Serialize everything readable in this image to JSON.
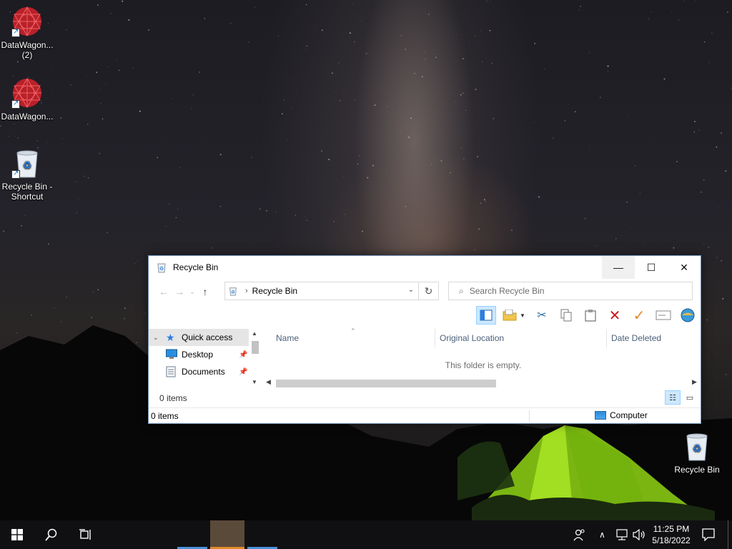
{
  "desktop": {
    "icons": [
      {
        "label": "DataWagon...\n(2)",
        "icon": "datawagon-icon",
        "shortcut": true
      },
      {
        "label": "DataWagon...",
        "icon": "datawagon-icon",
        "shortcut": true
      },
      {
        "label": "Recycle Bin - Shortcut",
        "icon": "recycle-bin-icon",
        "shortcut": true
      },
      {
        "label": "Recycle Bin",
        "icon": "recycle-bin-icon",
        "shortcut": false
      }
    ]
  },
  "window": {
    "title": "Recycle Bin",
    "controls": {
      "minimize": "—",
      "maximize": "☐",
      "close": "✕"
    },
    "address": {
      "crumb": "Recycle Bin",
      "sep": "›"
    },
    "search": {
      "placeholder": "Search Recycle Bin"
    },
    "toolbar_icons": [
      "preview-pane-icon",
      "new-folder-icon",
      "cut-icon",
      "copy-icon",
      "paste-icon",
      "delete-icon",
      "checkmark-icon",
      "rename-icon",
      "properties-icon"
    ],
    "nav_pane": {
      "items": [
        {
          "label": "Quick access",
          "icon": "star-icon",
          "selected": true,
          "expander": "⌄"
        },
        {
          "label": "Desktop",
          "icon": "desktop-folder-icon",
          "pinned": true
        },
        {
          "label": "Documents",
          "icon": "documents-folder-icon",
          "pinned": true
        }
      ],
      "items_count": "0 items"
    },
    "columns": [
      "Name",
      "Original Location",
      "Date Deleted"
    ],
    "empty_message": "This folder is empty.",
    "status": {
      "items": "0 items",
      "location": "Computer"
    }
  },
  "taskbar": {
    "clock_time": "11:25 PM",
    "clock_date": "5/18/2022",
    "accent_color": "#4a90d9",
    "active_app_color": "#e08a2b"
  }
}
